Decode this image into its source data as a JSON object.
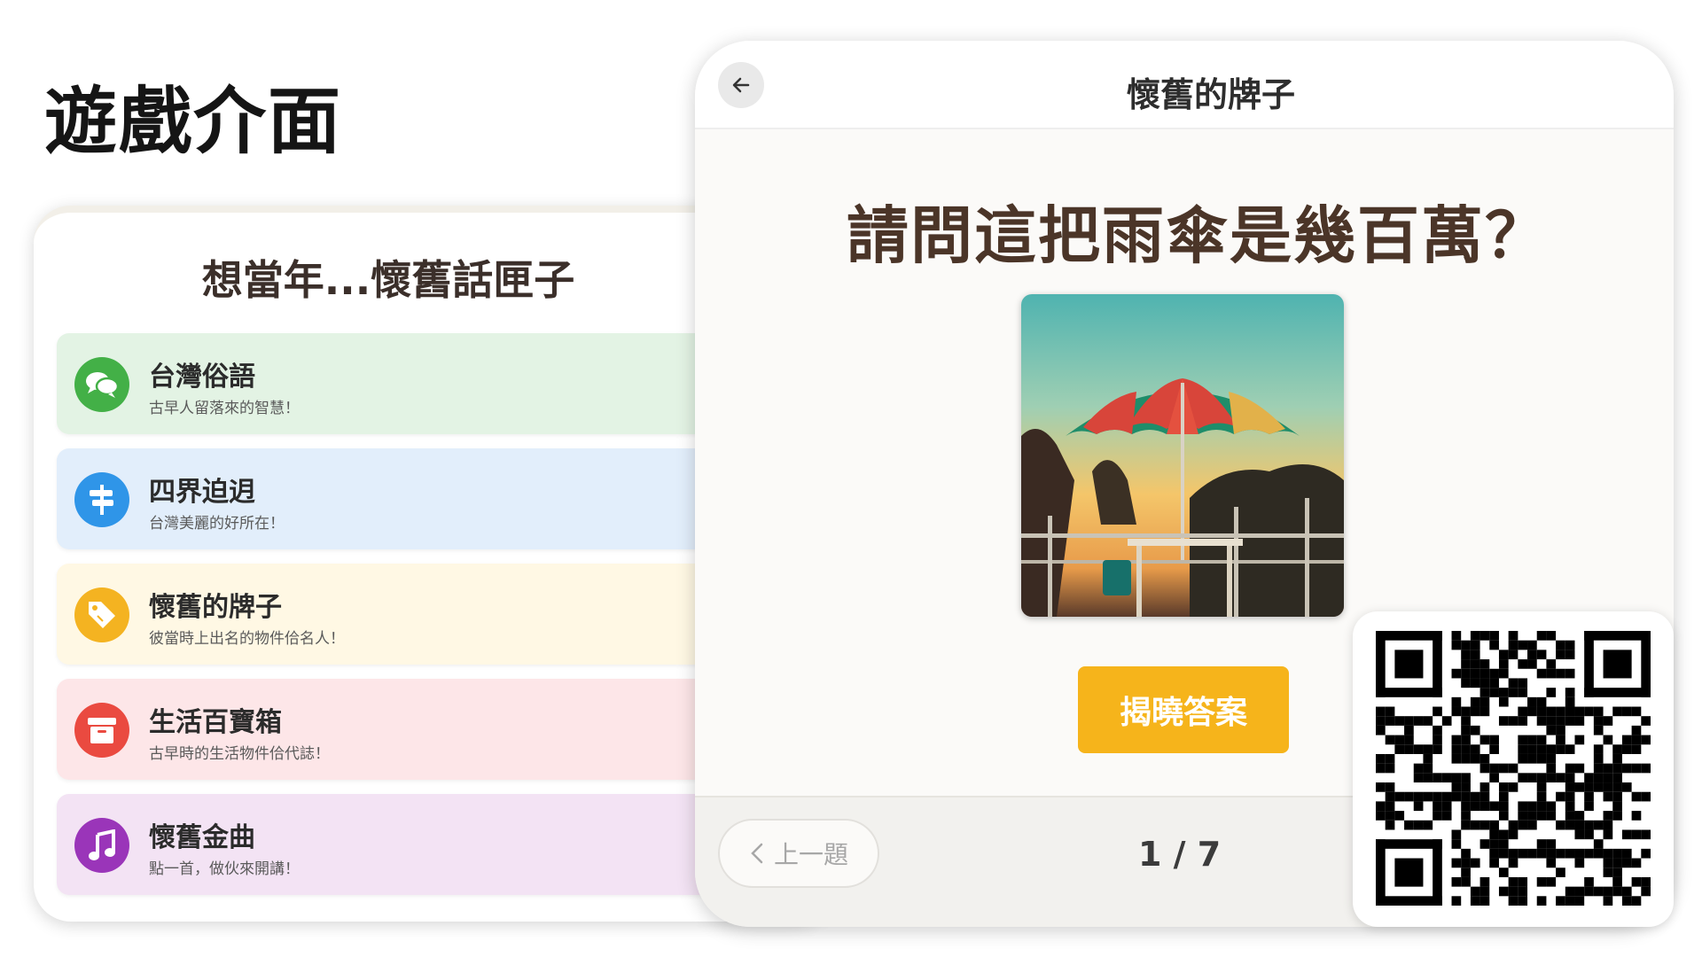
{
  "slide": {
    "title": "遊戲介面"
  },
  "menu": {
    "title": "想當年...懷舊話匣子",
    "items": [
      {
        "title": "台灣俗語",
        "subtitle": "古早人留落來的智慧！",
        "icon": "chat-bubbles-icon",
        "icon_color": "#43b047",
        "bg_color": "#e3f3e4"
      },
      {
        "title": "四界迫迌",
        "subtitle": "台灣美麗的好所在！",
        "icon": "signpost-icon",
        "icon_color": "#2f95e8",
        "bg_color": "#e2eefb"
      },
      {
        "title": "懷舊的牌子",
        "subtitle": "彼當時上出名的物件佮名人！",
        "icon": "tag-icon",
        "icon_color": "#f4b321",
        "bg_color": "#fff8e4"
      },
      {
        "title": "生活百寶箱",
        "subtitle": "古早時的生活物件佮代誌！",
        "icon": "archive-box-icon",
        "icon_color": "#ea4a40",
        "bg_color": "#fde6e8"
      },
      {
        "title": "懷舊金曲",
        "subtitle": "點一首，做伙來開講！",
        "icon": "music-note-icon",
        "icon_color": "#9a35b9",
        "bg_color": "#f3e3f4"
      }
    ]
  },
  "game": {
    "header_title": "懷舊的牌子",
    "question": "請問這把雨傘是幾百萬？",
    "image_subject": "beach umbrella at sunset",
    "reveal_label": "揭曉答案",
    "prev_label": "上一題",
    "progress": "1 / 7",
    "accent_color": "#f6b41b"
  },
  "qr": {
    "icon": "qr-code-icon"
  }
}
